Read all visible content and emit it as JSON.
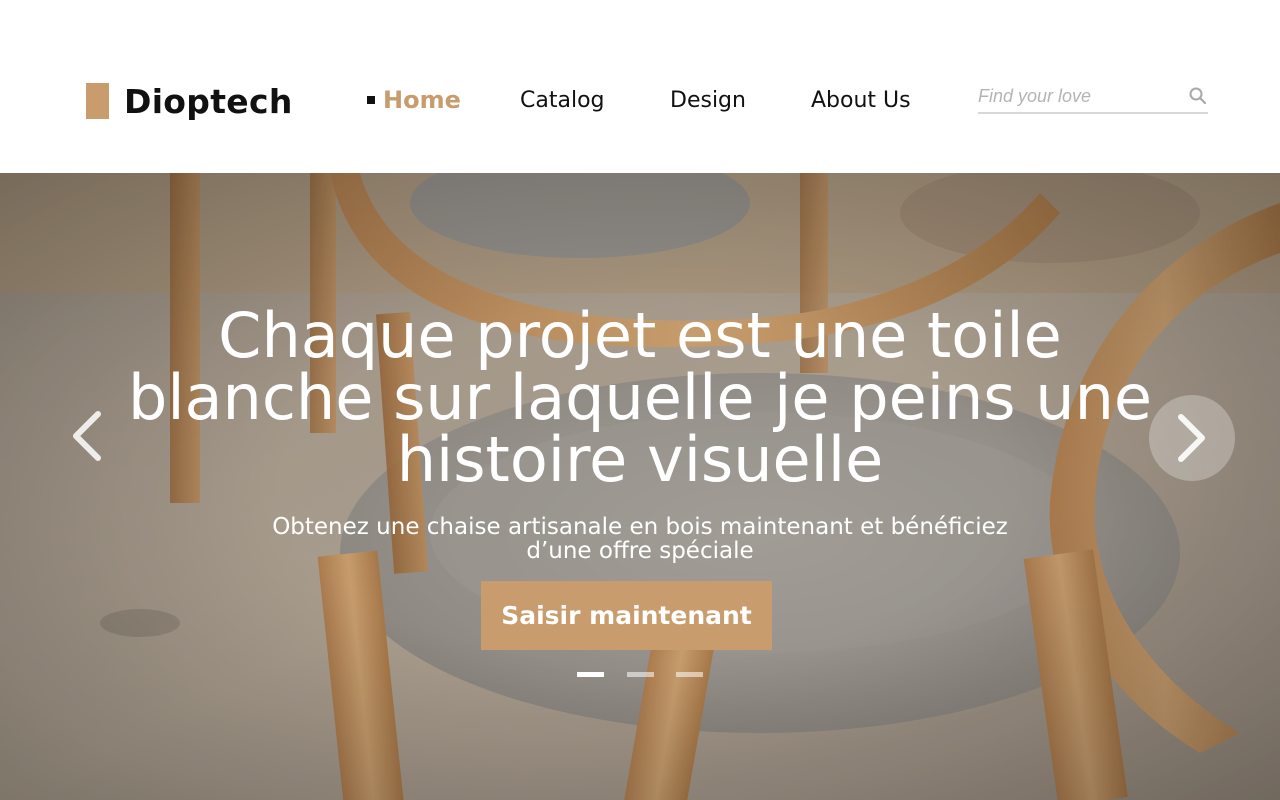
{
  "brand": {
    "name": "Dioptech",
    "accent_color": "#c89c6c"
  },
  "nav": {
    "items": [
      {
        "label": "Home",
        "active": true
      },
      {
        "label": "Catalog",
        "active": false
      },
      {
        "label": "Design",
        "active": false
      },
      {
        "label": "About Us",
        "active": false
      }
    ]
  },
  "search": {
    "placeholder": "Find your love",
    "value": "",
    "icon": "search-icon"
  },
  "hero": {
    "title_lines": [
      "Chaque projet est une toile",
      "blanche sur laquelle je peins une",
      "histoire visuelle"
    ],
    "subtitle_lines": [
      "Obtenez une chaise artisanale en bois maintenant et bénéficiez",
      "d’une offre spéciale"
    ],
    "cta_label": "Saisir maintenant",
    "background": "wooden chairs with grey cushioned seats",
    "slides_total": 3,
    "active_slide": 1,
    "prev_icon": "chevron-left-icon",
    "next_icon": "chevron-right-icon"
  }
}
